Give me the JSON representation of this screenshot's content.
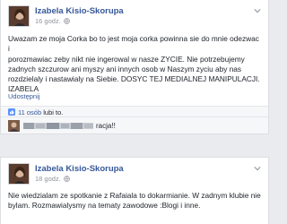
{
  "posts": [
    {
      "author": "Izabela Kisio-Skorupa",
      "time": "16 godz.",
      "text": "Uwazam ze moja Corka bo to jest moja corka powinna sie do mnie odezwac i\nporozmawiac zeby nikt nie ingerowal w nasze ZYCIE. Nie potrzebujemy\nzadnych szczurow ani myszy ani innych osob w Naszym zyciu aby nas\nrozdzielaly i nastawialy na Siebie. DOSYC TEJ MEDIALNEJ MANIPULACJI.\nIZABELA",
      "share_label": "Udostępnij",
      "likes_link": "11 osób",
      "likes_rest": "lubi to.",
      "comment_text": "racja!!"
    },
    {
      "author": "Izabela Kisio-Skorupa",
      "time": "18 godz.",
      "text": "Nie wiedzialam ze spotkanie z Rafaiala to dokarmianie. W zadnym klubie nie\nbylam. Rozmawialysmy na tematy zawodowe :Blogi i inne."
    }
  ],
  "colors": {
    "link": "#365899",
    "meta": "#90949c",
    "background": "#e9ebee"
  },
  "icons": [
    "globe-icon",
    "chevron-down-icon",
    "like-thumb-icon",
    "avatar"
  ]
}
